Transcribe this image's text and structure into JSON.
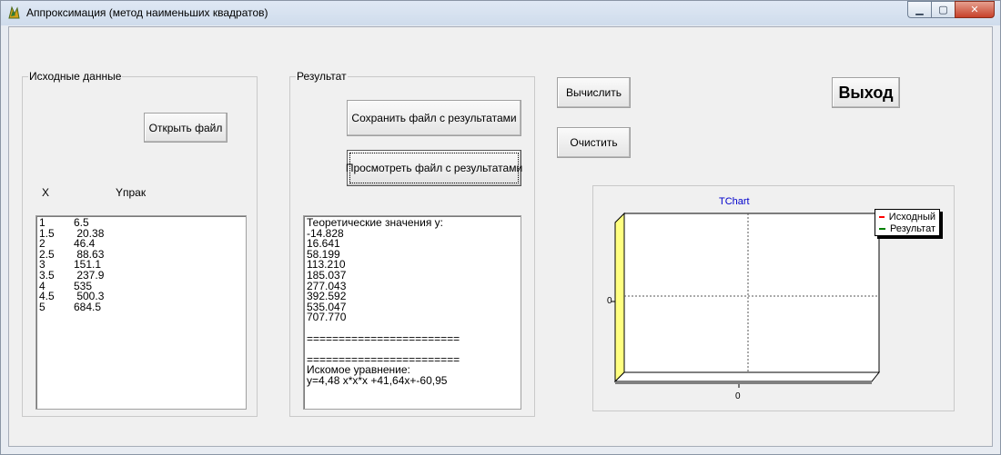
{
  "window": {
    "title": "Аппроксимация (метод наименьших квадратов)",
    "icon": "app-icon",
    "controls": [
      "minimize",
      "maximize",
      "close"
    ]
  },
  "source_group": {
    "caption": "Исходные данные",
    "open_button": "Открыть файл",
    "col_x": "X",
    "col_y": "Yпрак",
    "rows": [
      {
        "x": "1",
        "y": "6.5"
      },
      {
        "x": "1.5",
        "y": " 20.38"
      },
      {
        "x": "2",
        "y": "46.4"
      },
      {
        "x": "2.5",
        "y": " 88.63"
      },
      {
        "x": "3",
        "y": "151.1"
      },
      {
        "x": "3.5",
        "y": " 237.9"
      },
      {
        "x": "4",
        "y": "535"
      },
      {
        "x": "4.5",
        "y": " 500.3"
      },
      {
        "x": "5",
        "y": "684.5"
      }
    ]
  },
  "result_group": {
    "caption": "Результат",
    "save_button": "Сохранить файл с результатами",
    "view_button": "Просмотреть файл с результатами",
    "lines": [
      "Теоретические значения у:",
      "-14.828",
      "16.641",
      "58.199",
      "113.210",
      "185.037",
      "277.043",
      "392.592",
      "535.047",
      "707.770",
      "",
      "========================",
      "",
      "========================",
      "Искомое уравнение:",
      "у=4,48 x*x*x +41,64x+-60,95"
    ]
  },
  "actions": {
    "compute_button": "Вычислить",
    "clear_button": "Очистить",
    "exit_button": "Выход"
  },
  "chart": {
    "title": "TChart",
    "legend": [
      {
        "name": "Исходный",
        "color": "#ff0000"
      },
      {
        "name": "Результат",
        "color": "#008000"
      }
    ],
    "y_tick": "0",
    "x_tick": "0"
  },
  "chart_data": {
    "type": "line",
    "title": "TChart",
    "series": [
      {
        "name": "Исходный",
        "values": []
      },
      {
        "name": "Результат",
        "values": []
      }
    ],
    "y_ticks": [
      "0"
    ],
    "x_ticks": [
      "0"
    ],
    "grid": true,
    "legend_position": "top-right"
  }
}
